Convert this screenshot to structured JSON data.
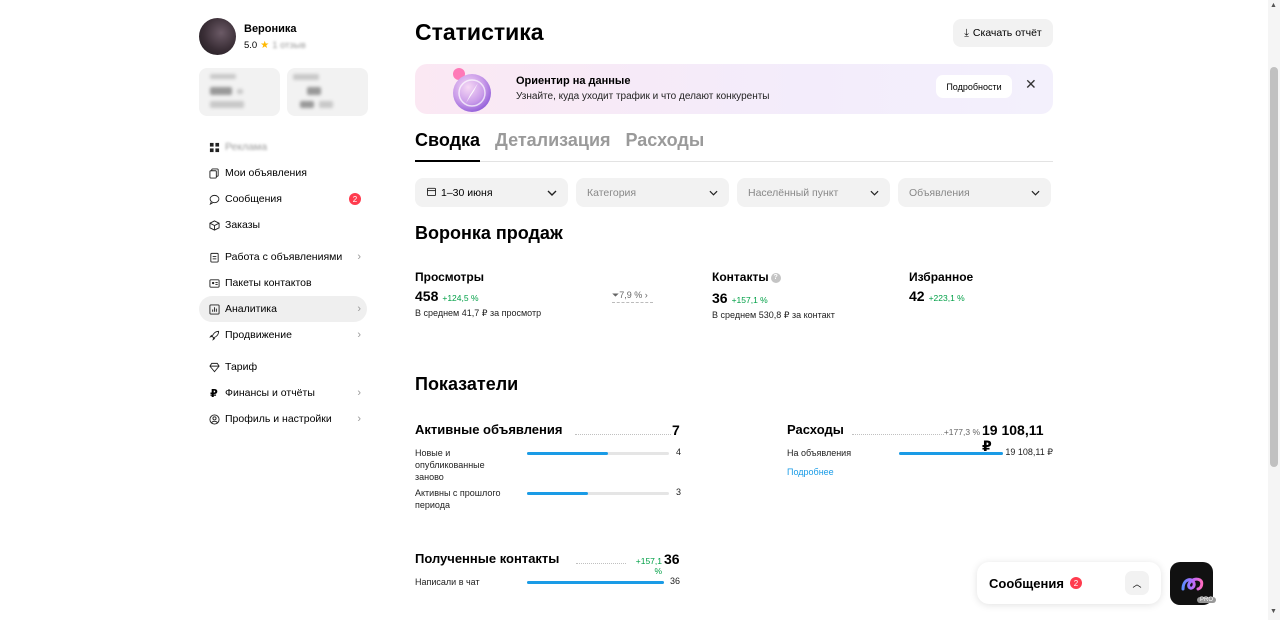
{
  "profile": {
    "name": "Вероника",
    "rating": "5.0",
    "reviews": "1 отзыв"
  },
  "sidebar": {
    "blurred_top": "Реклама",
    "items": [
      {
        "label": "Мои объявления",
        "icon": "copy-icon"
      },
      {
        "label": "Сообщения",
        "icon": "chat-icon",
        "badge": "2"
      },
      {
        "label": "Заказы",
        "icon": "box-icon"
      },
      {
        "label": "Работа с объявлениями",
        "icon": "clipboard-icon",
        "chevron": true
      },
      {
        "label": "Пакеты контактов",
        "icon": "contacts-icon"
      },
      {
        "label": "Аналитика",
        "icon": "chart-icon",
        "chevron": true,
        "active": true
      },
      {
        "label": "Продвижение",
        "icon": "rocket-icon",
        "chevron": true
      },
      {
        "label": "Тариф",
        "icon": "diamond-icon"
      },
      {
        "label": "Финансы и отчёты",
        "icon": "ruble-icon",
        "chevron": true
      },
      {
        "label": "Профиль и настройки",
        "icon": "user-icon",
        "chevron": true
      }
    ]
  },
  "header": {
    "title": "Статистика",
    "download_label": "Скачать отчёт"
  },
  "banner": {
    "title": "Ориентир на данные",
    "subtitle": "Узнайте, куда уходит трафик и что делают конкуренты",
    "button": "Подробности"
  },
  "tabs": [
    "Сводка",
    "Детализация",
    "Расходы"
  ],
  "filters": {
    "period": "1–30 июня",
    "category": "Категория",
    "city": "Населённый пункт",
    "ads": "Объявления"
  },
  "funnel": {
    "title": "Воронка продаж",
    "views": {
      "label": "Просмотры",
      "value": "458",
      "delta": "+124,5 %",
      "note": "В среднем 41,7 ₽ за просмотр",
      "conversion": "7,9 %"
    },
    "contacts": {
      "label": "Контакты",
      "value": "36",
      "delta": "+157,1 %",
      "note": "В среднем 530,8 ₽ за контакт"
    },
    "favorites": {
      "label": "Избранное",
      "value": "42",
      "delta": "+223,1 %"
    }
  },
  "metrics": {
    "title": "Показатели",
    "active": {
      "label": "Активные объявления",
      "value": "7",
      "rows": [
        {
          "label": "Новые и опубликованные заново",
          "value": "4",
          "fill": 0.57
        },
        {
          "label": "Активны с прошлого периода",
          "value": "3",
          "fill": 0.43
        }
      ]
    },
    "expenses": {
      "label": "Расходы",
      "delta": "+177,3 %",
      "value": "19 108,11 ₽",
      "rows": [
        {
          "label": "На объявления",
          "value": "19 108,11 ₽",
          "fill": 1.0
        }
      ],
      "link": "Подробнее"
    },
    "contacts": {
      "label": "Полученные контакты",
      "delta": "+157,1 %",
      "value": "36",
      "rows": [
        {
          "label": "Написали в чат",
          "value": "36",
          "fill": 1.0
        }
      ]
    }
  },
  "messages_popup": {
    "label": "Сообщения",
    "badge": "2"
  },
  "app": {
    "tag": "PRO"
  }
}
